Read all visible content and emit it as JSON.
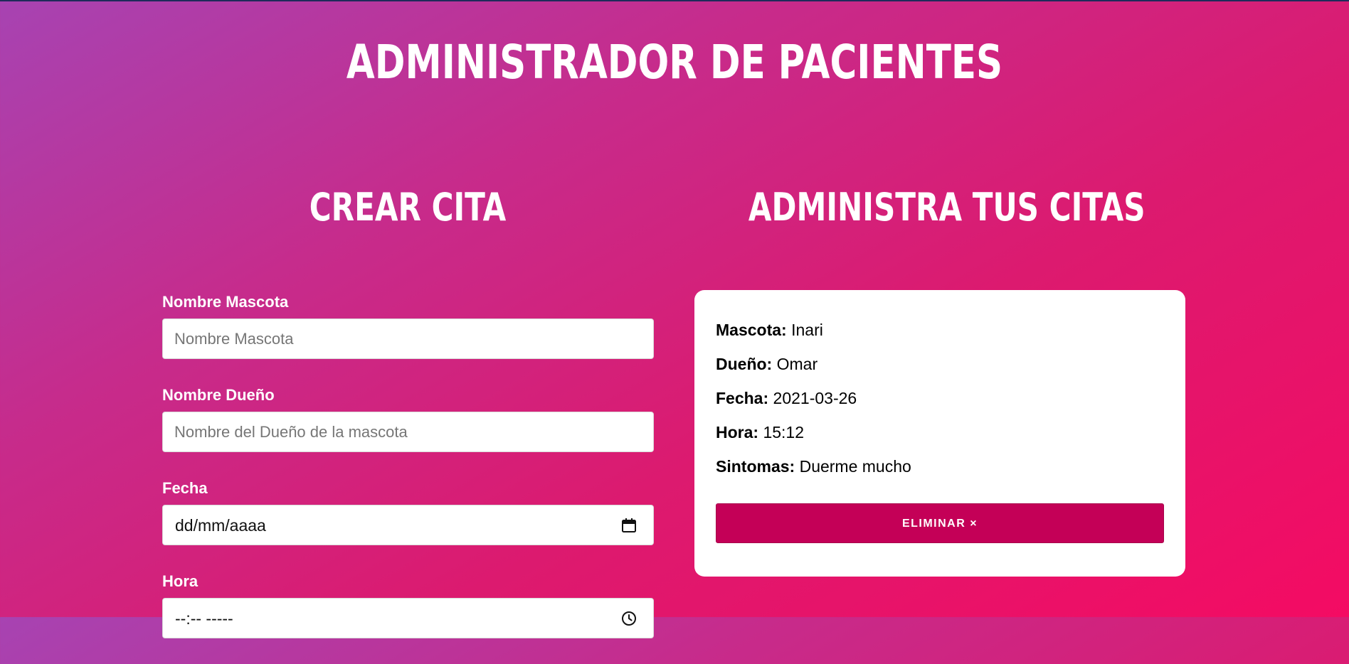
{
  "page": {
    "title": "Administrador de Pacientes"
  },
  "create": {
    "title": "Crear cita",
    "fields": [
      {
        "label": "Nombre Mascota",
        "placeholder": "Nombre Mascota"
      },
      {
        "label": "Nombre Dueño",
        "placeholder": "Nombre del Dueño de la mascota"
      },
      {
        "label": "Fecha",
        "value": "dd/mm/aaaa",
        "icon": "calendar-icon"
      },
      {
        "label": "Hora",
        "value": "--:-- -----",
        "icon": "clock-icon"
      }
    ]
  },
  "manage": {
    "title": "Administra tus citas",
    "appointment": {
      "pet_label": "Mascota:",
      "pet": "Inari",
      "owner_label": "Dueño:",
      "owner": "Omar",
      "date_label": "Fecha:",
      "date": "2021-03-26",
      "time_label": "Hora:",
      "time": "15:12",
      "symptoms_label": "Sintomas:",
      "symptoms": "Duerme mucho",
      "delete_label": "Eliminar ×"
    }
  },
  "colors": {
    "gradient_start": "#a743b2",
    "gradient_end": "#f40b63",
    "delete_button": "#c40057",
    "text_light": "#ffffff"
  }
}
